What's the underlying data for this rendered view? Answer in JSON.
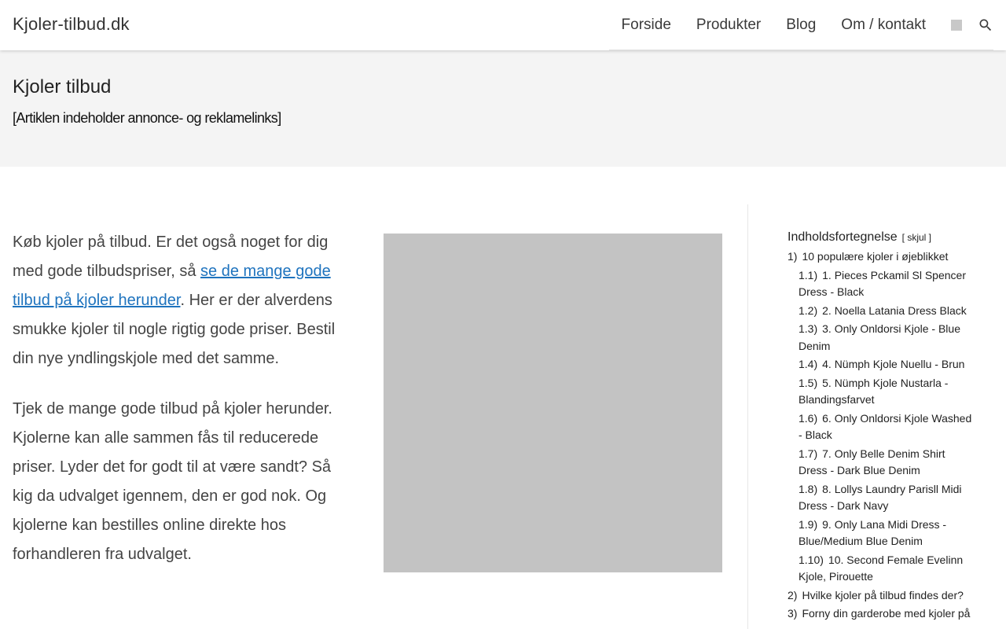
{
  "header": {
    "brand": "Kjoler-tilbud.dk",
    "nav": [
      "Forside",
      "Produkter",
      "Blog",
      "Om / kontakt"
    ],
    "cart_icon": "cart-placeholder-icon",
    "search_icon": "search-icon"
  },
  "title_band": {
    "title": "Kjoler tilbud",
    "disclaimer": "[Artiklen indeholder annonce- og reklamelinks]"
  },
  "content": {
    "p1_before": "Køb kjoler på tilbud. Er det også noget for dig med gode tilbudspriser, så ",
    "p1_link": "se de mange gode tilbud på kjoler herunder",
    "p1_after": ". Her er der alverdens smukke kjoler til nogle rigtig gode priser. Bestil din nye yndlingskjole med det samme.",
    "p2": "Tjek de mange gode tilbud på kjoler herunder. Kjolerne kan alle sammen fås til reducerede priser. Lyder det for godt til at være sandt? Så kig da udvalget igennem, den er god nok. Og kjolerne kan bestilles online direkte hos forhandleren fra udvalget."
  },
  "toc": {
    "title": "Indholdsfortegnelse",
    "toggle": "[ skjul ]",
    "items": [
      {
        "num": "1)",
        "label": "10 populære kjoler i øjeblikket",
        "level": 1
      },
      {
        "num": "1.1)",
        "label": "1. Pieces Pckamil Sl Spencer Dress - Black",
        "level": 2
      },
      {
        "num": "1.2)",
        "label": "2. Noella Latania Dress Black",
        "level": 2
      },
      {
        "num": "1.3)",
        "label": "3. Only Onldorsi Kjole - Blue Denim",
        "level": 2
      },
      {
        "num": "1.4)",
        "label": "4. Nümph Kjole Nuellu - Brun",
        "level": 2
      },
      {
        "num": "1.5)",
        "label": "5. Nümph Kjole Nustarla - Blandingsfarvet",
        "level": 2
      },
      {
        "num": "1.6)",
        "label": "6. Only Onldorsi Kjole Washed - Black",
        "level": 2
      },
      {
        "num": "1.7)",
        "label": "7. Only Belle Denim Shirt Dress - Dark Blue Denim",
        "level": 2
      },
      {
        "num": "1.8)",
        "label": "8. Lollys Laundry Parisll Midi Dress - Dark Navy",
        "level": 2
      },
      {
        "num": "1.9)",
        "label": "9. Only Lana Midi Dress - Blue/Medium Blue Denim",
        "level": 2
      },
      {
        "num": "1.10)",
        "label": "10. Second Female Evelinn Kjole, Pirouette",
        "level": 2
      },
      {
        "num": "2)",
        "label": "Hvilke kjoler på tilbud findes der?",
        "level": 1
      },
      {
        "num": "3)",
        "label": "Forny din garderobe med kjoler på",
        "level": 1
      }
    ]
  },
  "colors": {
    "link": "#1e73be",
    "band_bg": "#f4f4f4",
    "placeholder": "#c3c3c3"
  }
}
